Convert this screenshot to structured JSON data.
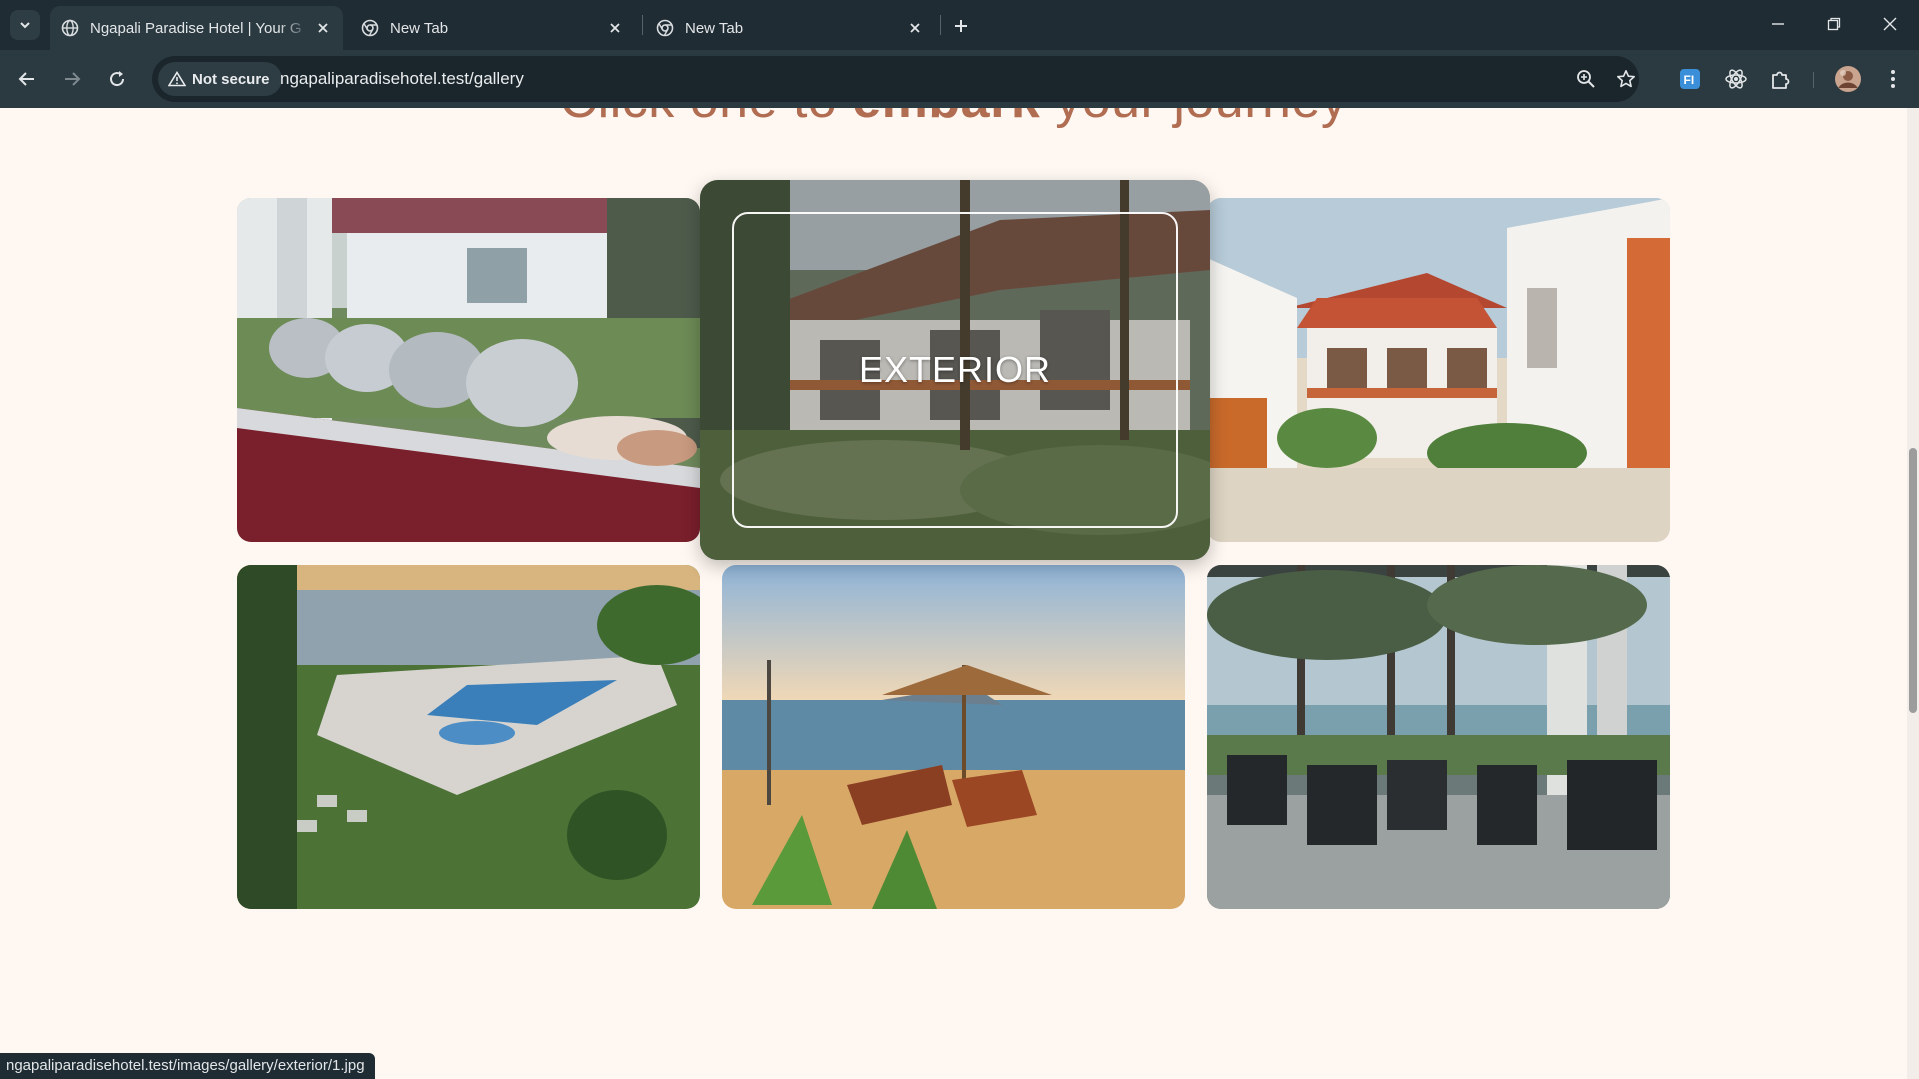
{
  "browser": {
    "tabs": [
      {
        "title": "Ngapali Paradise Hotel | Your G",
        "active": true
      },
      {
        "title": "New Tab",
        "active": false
      },
      {
        "title": "New Tab",
        "active": false
      }
    ],
    "security_label": "Not secure",
    "url": "ngapaliparadisehotel.test/gallery",
    "status_url": "ngapaliparadisehotel.test/images/gallery/exterior/1.jpg",
    "icons": [
      "tab-search-icon",
      "globe-icon",
      "chrome-icon",
      "close-icon",
      "plus-icon",
      "minimize-icon",
      "restore-icon",
      "back-icon",
      "forward-icon",
      "reload-icon",
      "warning-icon",
      "zoom-icon",
      "star-icon",
      "extension-fi-icon",
      "react-icon",
      "puzzle-icon",
      "avatar",
      "kebab-menu-icon"
    ]
  },
  "page": {
    "heading_pre": "Click one to ",
    "heading_bold": "embark",
    "heading_post": " your journey",
    "hover_label": "EXTERIOR",
    "tiles": [
      "buffet-photo",
      "exterior-photo",
      "bungalow-photo",
      "pool-photo",
      "beach-photo",
      "restaurant-photo"
    ]
  },
  "colors": {
    "page_bg": "#fff8f2",
    "heading": "#b06d52",
    "chrome_dark": "#1f2c33",
    "chrome_toolbar": "#2b3a41"
  }
}
